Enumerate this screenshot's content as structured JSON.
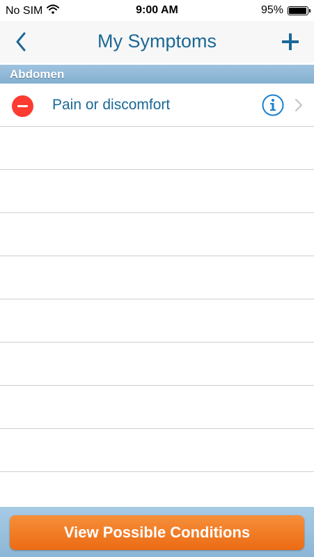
{
  "status_bar": {
    "carrier": "No SIM",
    "time": "9:00 AM",
    "battery_percent": "95%",
    "battery_level": 0.95
  },
  "nav": {
    "title": "My Symptoms",
    "back_icon": "chevron-left-icon",
    "add_icon": "plus-icon"
  },
  "section": {
    "title": "Abdomen"
  },
  "symptoms": [
    {
      "label": "Pain or discomfort"
    }
  ],
  "bottom": {
    "button_label": "View Possible Conditions"
  },
  "colors": {
    "accent": "#1a6896",
    "delete": "#fd3b30",
    "button": "#ec6b14",
    "info": "#1a7fcf"
  }
}
